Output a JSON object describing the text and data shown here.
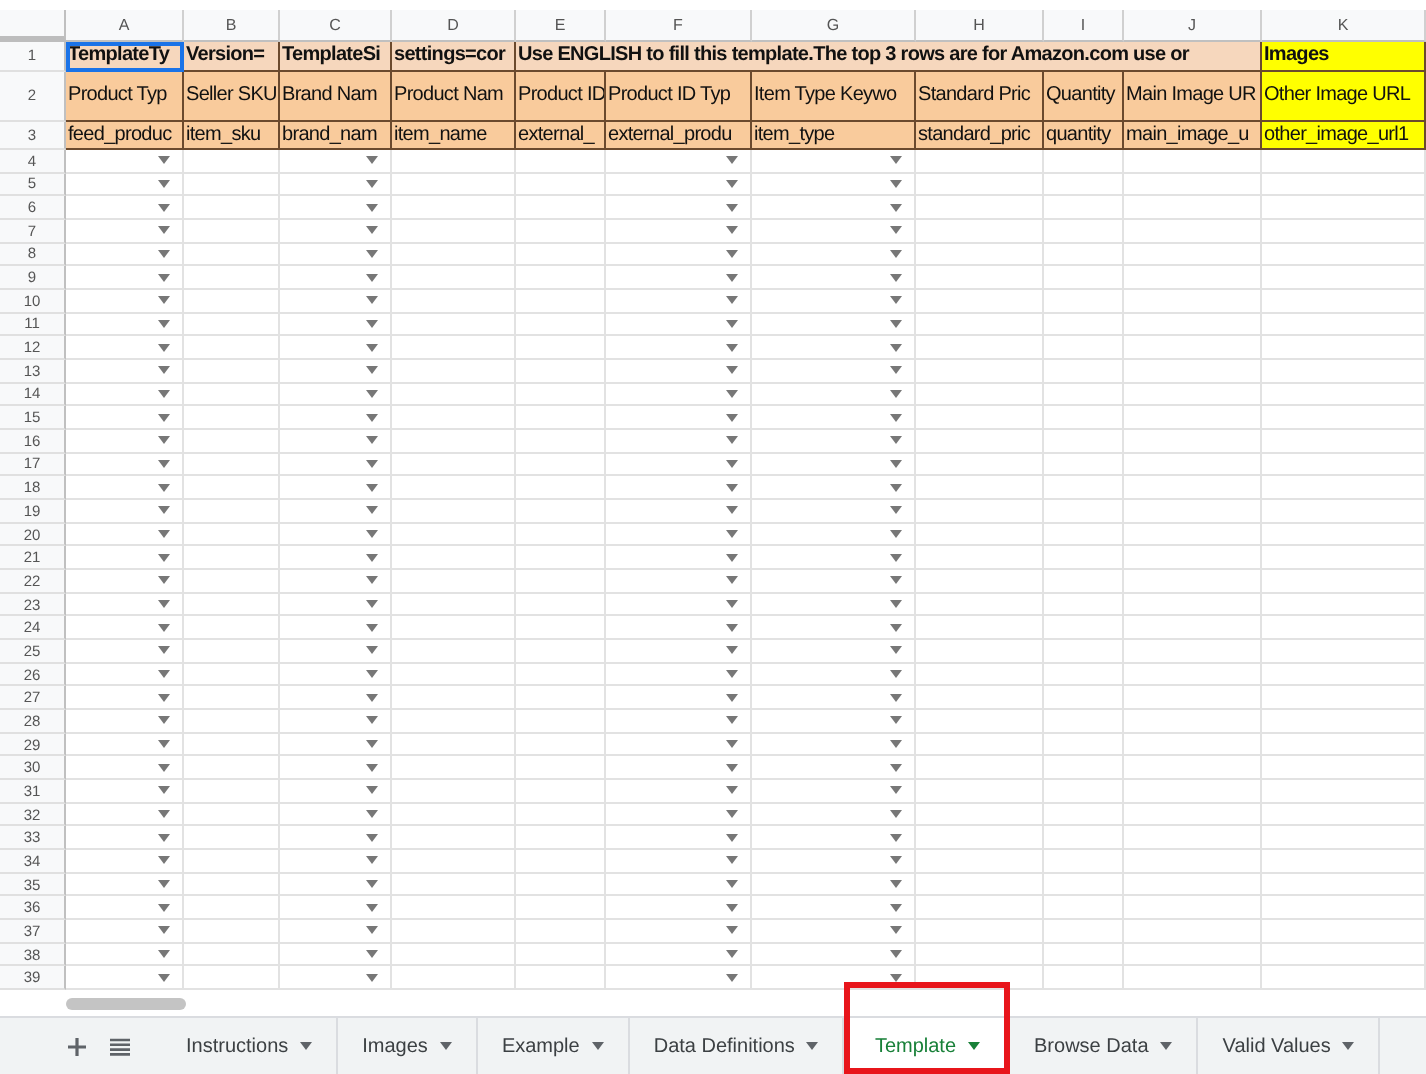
{
  "columns": [
    {
      "letter": "A",
      "dropdown": true
    },
    {
      "letter": "B",
      "dropdown": false
    },
    {
      "letter": "C",
      "dropdown": true
    },
    {
      "letter": "D",
      "dropdown": false
    },
    {
      "letter": "E",
      "dropdown": false
    },
    {
      "letter": "F",
      "dropdown": true
    },
    {
      "letter": "G",
      "dropdown": true
    },
    {
      "letter": "H",
      "dropdown": false
    },
    {
      "letter": "I",
      "dropdown": false
    },
    {
      "letter": "J",
      "dropdown": false
    },
    {
      "letter": "K",
      "dropdown": false
    }
  ],
  "header_rows": [
    {
      "number": "1",
      "kind": "banner",
      "cells": [
        {
          "text": "TemplateTy",
          "overflows": false,
          "color": "#f6d7bd",
          "selected": true
        },
        {
          "text": "Version=",
          "overflows": false,
          "color": "#f6d7bd",
          "selected": false
        },
        {
          "text": "TemplateSi",
          "overflows": false,
          "color": "#f6d7bd",
          "selected": false
        },
        {
          "text": "settings=cor",
          "overflows": false,
          "color": "#f6d7bd",
          "selected": false
        },
        {
          "text": "Use ENGLISH to fill this template.The top 3 rows are for Amazon.com use or",
          "overflows": true,
          "color": "#f6d7bd",
          "selected": false
        },
        {
          "text": "Images",
          "overflows": false,
          "color": "#ffff00",
          "selected": false
        }
      ]
    },
    {
      "number": "2",
      "kind": "label",
      "cells": [
        {
          "text": "Product Typ",
          "color": "#f9cb9c",
          "selected": false
        },
        {
          "text": "Seller SKU",
          "color": "#f9cb9c",
          "selected": false
        },
        {
          "text": "Brand Nam",
          "color": "#f9cb9c",
          "selected": false
        },
        {
          "text": "Product Nam",
          "color": "#f9cb9c",
          "selected": false
        },
        {
          "text": "Product ID",
          "color": "#f9cb9c",
          "selected": false
        },
        {
          "text": "Product ID Typ",
          "color": "#f9cb9c",
          "selected": false
        },
        {
          "text": "Item Type Keywo",
          "color": "#f9cb9c",
          "selected": false
        },
        {
          "text": "Standard Pric",
          "color": "#f9cb9c",
          "selected": false
        },
        {
          "text": "Quantity",
          "color": "#f9cb9c",
          "selected": false
        },
        {
          "text": "Main Image UR",
          "color": "#f9cb9c",
          "selected": false
        },
        {
          "text": "Other Image URL",
          "color": "#ffff00",
          "selected": false
        }
      ]
    },
    {
      "number": "3",
      "kind": "field",
      "cells": [
        {
          "text": "feed_produc",
          "color": "#f9cb9c",
          "selected": false
        },
        {
          "text": "item_sku",
          "color": "#f9cb9c",
          "selected": false
        },
        {
          "text": "brand_nam",
          "color": "#f9cb9c",
          "selected": false
        },
        {
          "text": "item_name",
          "color": "#f9cb9c",
          "selected": false
        },
        {
          "text": "external_",
          "color": "#f9cb9c",
          "selected": false
        },
        {
          "text": "external_produ",
          "color": "#f9cb9c",
          "selected": false
        },
        {
          "text": "item_type",
          "color": "#f9cb9c",
          "selected": false
        },
        {
          "text": "standard_pric",
          "color": "#f9cb9c",
          "selected": false
        },
        {
          "text": "quantity",
          "color": "#f9cb9c",
          "selected": false
        },
        {
          "text": "main_image_u",
          "color": "#f9cb9c",
          "selected": false
        },
        {
          "text": "other_image_url1",
          "color": "#ffff00",
          "selected": false
        }
      ]
    }
  ],
  "rows": [
    "4",
    "5",
    "6",
    "7",
    "8",
    "9",
    "10",
    "11",
    "12",
    "13",
    "14",
    "15",
    "16",
    "17",
    "18",
    "19",
    "20",
    "21",
    "22",
    "23",
    "24",
    "25",
    "26",
    "27",
    "28",
    "29",
    "30",
    "31",
    "32",
    "33",
    "34",
    "35",
    "36",
    "37",
    "38",
    "39"
  ],
  "sheet_tabs": [
    {
      "label": "Instructions",
      "selected": false,
      "annotated": false
    },
    {
      "label": "Images",
      "selected": false,
      "annotated": false
    },
    {
      "label": "Example",
      "selected": false,
      "annotated": false
    },
    {
      "label": "Data Definitions",
      "selected": false,
      "annotated": false
    },
    {
      "label": "Template",
      "selected": true,
      "annotated": true
    },
    {
      "label": "Browse Data",
      "selected": false,
      "annotated": false
    },
    {
      "label": "Valid Values",
      "selected": false,
      "annotated": false
    }
  ]
}
